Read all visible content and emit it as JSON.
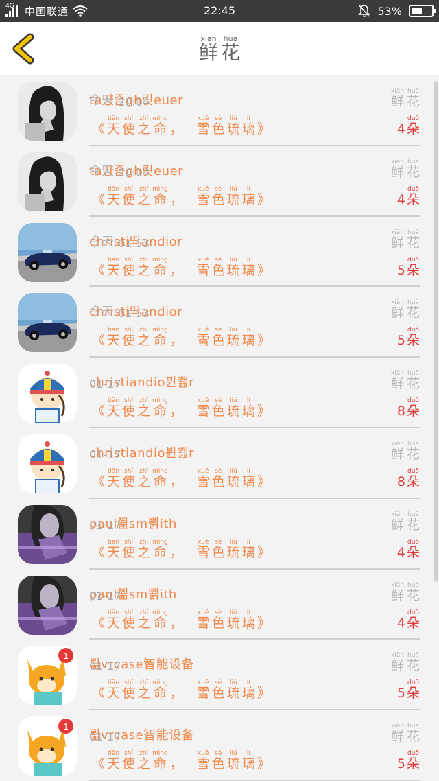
{
  "status_bar": {
    "network": "4G",
    "carrier": "中国联通",
    "time": "22:45",
    "battery": "53%",
    "battery_level": 0.53
  },
  "header": {
    "title_chars": [
      {
        "ch": "鲜",
        "py": "xiān"
      },
      {
        "ch": "花",
        "py": "huā"
      }
    ]
  },
  "labels": {
    "flower": [
      {
        "ch": "鲜",
        "py": "xiān"
      },
      {
        "ch": "花",
        "py": "huā"
      }
    ],
    "gift_open": "《",
    "gift_close": "》",
    "gift_part1": [
      {
        "ch": "天",
        "py": "tiān"
      },
      {
        "ch": "使",
        "py": "shǐ"
      },
      {
        "ch": "之",
        "py": "zhī"
      },
      {
        "ch": "命",
        "py": "mìng"
      }
    ],
    "comma": "，",
    "gift_part2": [
      {
        "ch": "雪",
        "py": "xuě"
      },
      {
        "ch": "色",
        "py": "sè"
      },
      {
        "ch": "琉",
        "py": "liú"
      },
      {
        "ch": "璃",
        "py": "lí"
      }
    ],
    "unit": {
      "ch": "朵",
      "py": "duǒ"
    }
  },
  "items": [
    {
      "user": "ta땽즘gh릿euer",
      "tag": "今天",
      "time": "20:04",
      "count": "4",
      "avatar": "girl"
    },
    {
      "user": "ta땽즘gh릿euer",
      "tag": "今天",
      "time": "20:04",
      "count": "4",
      "avatar": "girl"
    },
    {
      "user": "christi띄andior",
      "tag": "今天",
      "time": "01:53",
      "count": "5",
      "avatar": "car"
    },
    {
      "user": "christi띄andior",
      "tag": "今天",
      "time": "01:53",
      "count": "5",
      "avatar": "car"
    },
    {
      "user": "christiandio뷘뾆r",
      "tag": "",
      "time": "01-17",
      "count": "8",
      "avatar": "cartoon"
    },
    {
      "user": "christiandio뷘뾆r",
      "tag": "",
      "time": "01-17",
      "count": "8",
      "avatar": "cartoon"
    },
    {
      "user": "paul쬚sm뾝ith",
      "tag": "",
      "time": "01-17",
      "count": "4",
      "avatar": "woman"
    },
    {
      "user": "paul쬚sm뾝ith",
      "tag": "",
      "time": "01-17",
      "count": "4",
      "avatar": "woman"
    },
    {
      "user": "뢺vrcase智能设备",
      "tag": "",
      "time": "01-17",
      "count": "5",
      "avatar": "fox"
    },
    {
      "user": "뢺vrcase智能设备",
      "tag": "",
      "time": "01-17",
      "count": "5",
      "avatar": "fox"
    }
  ],
  "colors": {
    "accent": "#f0884a",
    "count": "#e03a3a",
    "muted": "#b8b8b8",
    "back": "#f5c400"
  }
}
